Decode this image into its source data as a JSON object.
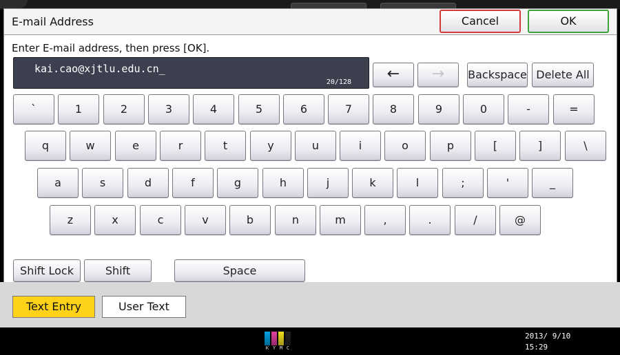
{
  "dialog": {
    "title": "E-mail Address",
    "cancel_label": "Cancel",
    "ok_label": "OK",
    "instruction": "Enter E-mail address, then press [OK].",
    "entry_value": "kai.cao@xjtlu.edu.cn_",
    "entry_count": "20/128"
  },
  "controls": {
    "arrow_left_icon": "left-arrow-icon",
    "arrow_right_icon": "right-arrow-icon",
    "left_arrow": "←",
    "right_arrow": "→",
    "backspace": "Backspace",
    "delete_all": "Delete All"
  },
  "keyboard": {
    "row1": [
      "`",
      "1",
      "2",
      "3",
      "4",
      "5",
      "6",
      "7",
      "8",
      "9",
      "0",
      "-",
      "="
    ],
    "row2": [
      "q",
      "w",
      "e",
      "r",
      "t",
      "y",
      "u",
      "i",
      "o",
      "p",
      "[",
      "]",
      "\\"
    ],
    "row3": [
      "a",
      "s",
      "d",
      "f",
      "g",
      "h",
      "j",
      "k",
      "l",
      ";",
      "'",
      "_"
    ],
    "row4": [
      "z",
      "x",
      "c",
      "v",
      "b",
      "n",
      "m",
      ",",
      ".",
      "/",
      "@"
    ]
  },
  "bottom_keys": {
    "shift_lock": "Shift Lock",
    "shift": "Shift",
    "space": "Space"
  },
  "tabs": {
    "text_entry": "Text Entry",
    "user_text": "User Text",
    "active_color": "#ffd21a"
  },
  "status": {
    "logo_colors": [
      "#00a0e0",
      "#e040a0",
      "#f0e020",
      "#202020"
    ],
    "logo_letters": [
      "K",
      "Y",
      "M",
      "C"
    ],
    "date": "2013/ 9/10",
    "time": "15:29"
  }
}
